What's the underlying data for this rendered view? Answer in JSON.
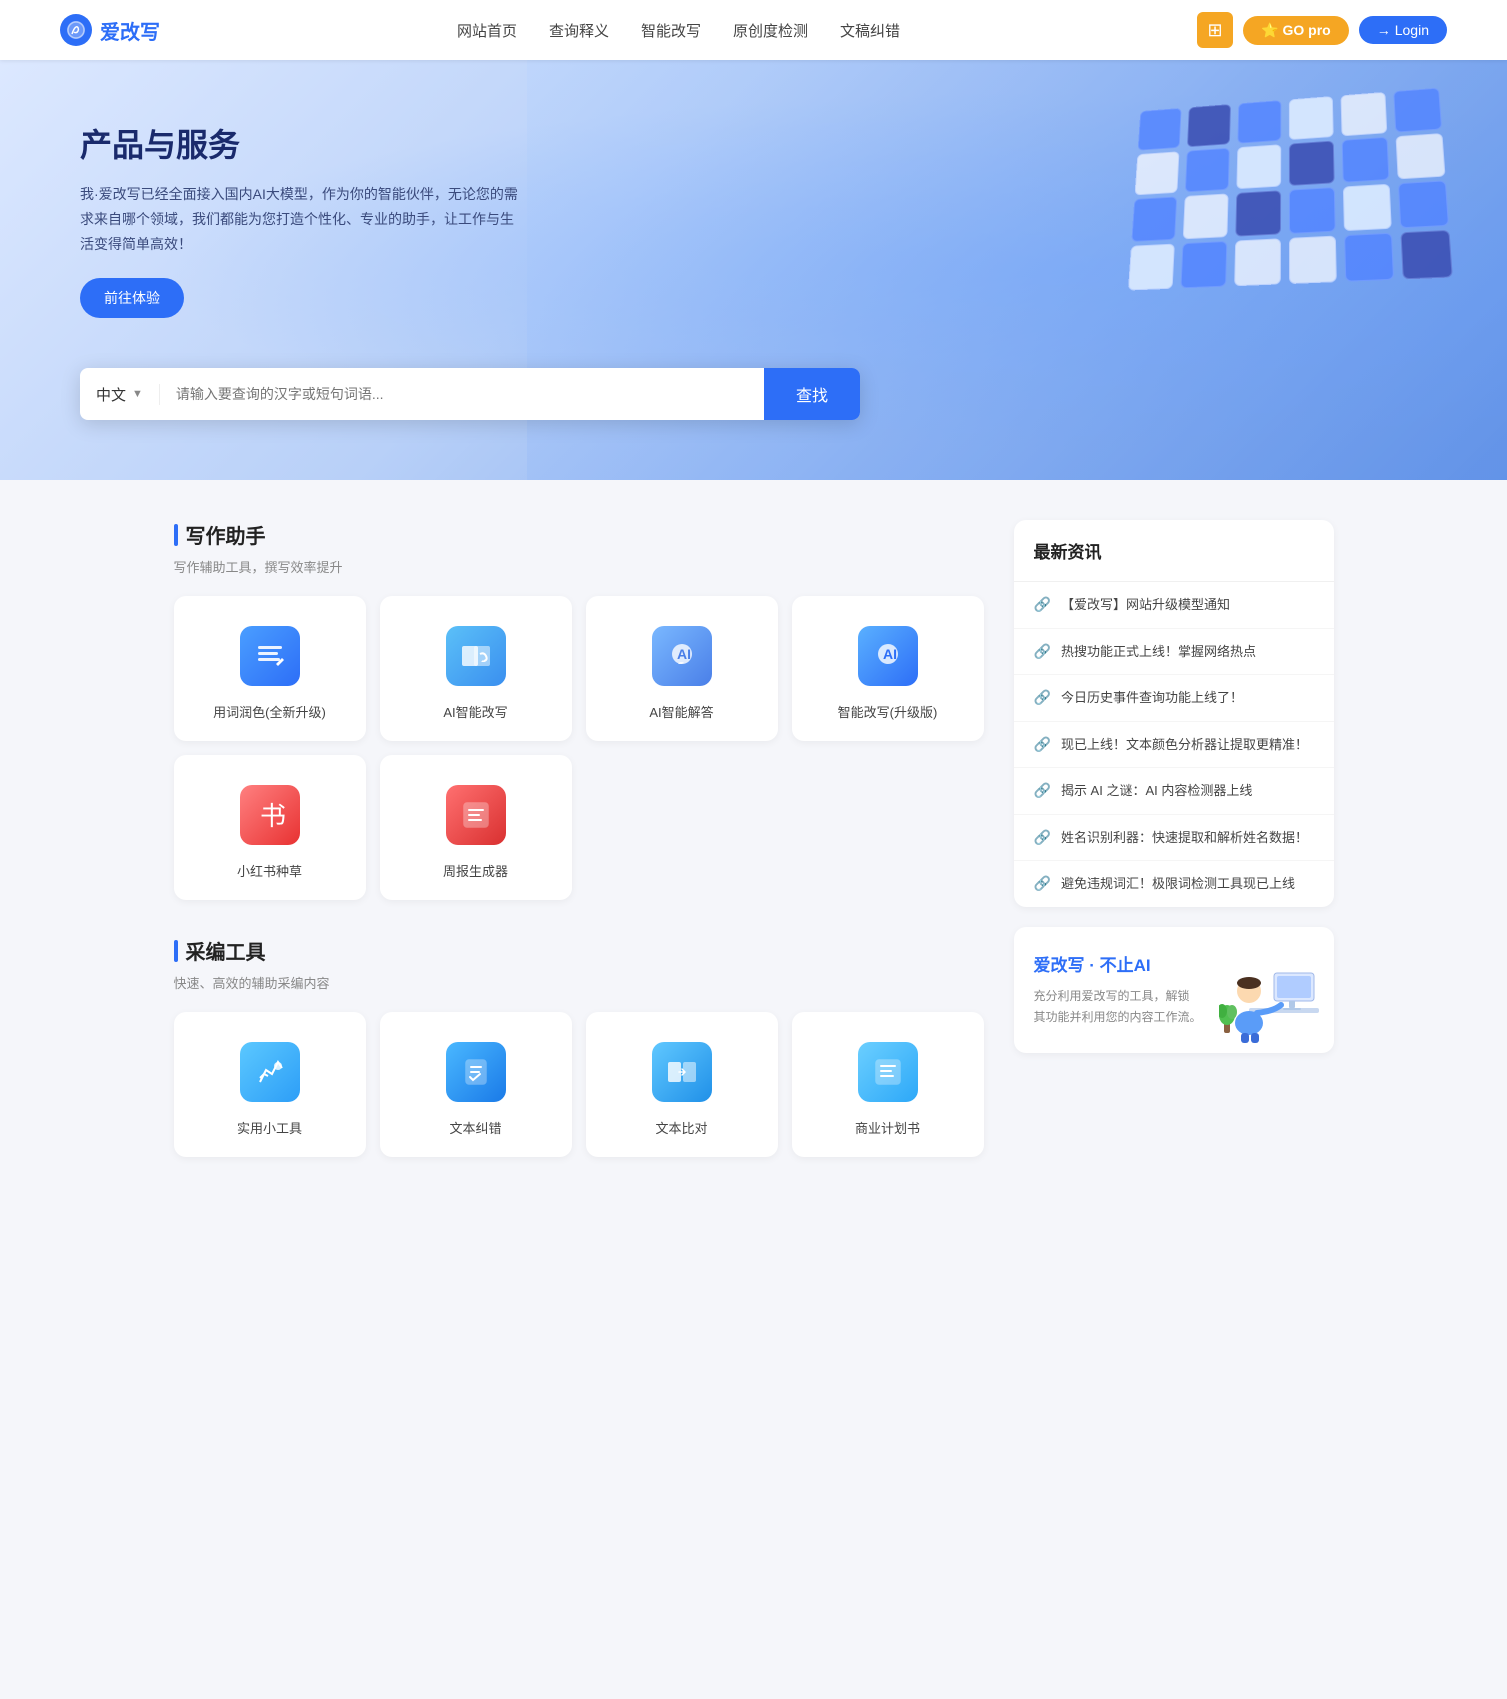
{
  "site": {
    "logo_text": "爱改写",
    "logo_icon": "✏"
  },
  "nav": {
    "links": [
      {
        "label": "网站首页",
        "id": "home"
      },
      {
        "label": "查询释义",
        "id": "query"
      },
      {
        "label": "智能改写",
        "id": "rewrite"
      },
      {
        "label": "原创度检测",
        "id": "originality"
      },
      {
        "label": "文稿纠错",
        "id": "proofread"
      }
    ],
    "btn_grid_icon": "⊞",
    "btn_go_label": "GO pro",
    "btn_login_label": "Login"
  },
  "hero": {
    "title": "产品与服务",
    "description": "我·爱改写已经全面接入国内AI大模型，作为你的智能伙伴，无论您的需求来自哪个领域，我们都能为您打造个性化、专业的助手，让工作与生活变得简单高效！",
    "trial_btn": "前往体验",
    "search_lang": "中文",
    "search_placeholder": "请输入要查询的汉字或短句词语...",
    "search_btn": "查找"
  },
  "writing_section": {
    "title": "写作助手",
    "subtitle": "写作辅助工具，撰写效率提升",
    "tools": [
      {
        "label": "用词润色(全新升级)",
        "icon_type": "writing"
      },
      {
        "label": "AI智能改写",
        "icon_type": "ai-rewrite"
      },
      {
        "label": "AI智能解答",
        "icon_type": "ai-answer"
      },
      {
        "label": "智能改写(升级版)",
        "icon_type": "smart-rewrite"
      },
      {
        "label": "小红书种草",
        "icon_type": "xiaohongshu"
      },
      {
        "label": "周报生成器",
        "icon_type": "weekly"
      }
    ]
  },
  "cabian_section": {
    "title": "采编工具",
    "subtitle": "快速、高效的辅助采编内容",
    "tools": [
      {
        "label": "实用小工具",
        "icon_type": "tools"
      },
      {
        "label": "文本纠错",
        "icon_type": "proofread"
      },
      {
        "label": "文本比对",
        "icon_type": "compare"
      },
      {
        "label": "商业计划书",
        "icon_type": "business"
      }
    ]
  },
  "news": {
    "title": "最新资讯",
    "items": [
      {
        "text": "【爱改写】网站升级模型通知"
      },
      {
        "text": "热搜功能正式上线！掌握网络热点"
      },
      {
        "text": "今日历史事件查询功能上线了！"
      },
      {
        "text": "现已上线！文本颜色分析器让提取更精准！"
      },
      {
        "text": "揭示 AI 之谜：AI 内容检测器上线"
      },
      {
        "text": "姓名识别利器：快速提取和解析姓名数据！"
      },
      {
        "text": "避免违规词汇！极限词检测工具现已上线"
      }
    ]
  },
  "promo": {
    "title_part1": "爱改写",
    "title_separator": "·",
    "title_part2": "不止AI",
    "description": "充分利用爱改写的工具，解锁\n其功能并利用您的内容工作流。"
  }
}
